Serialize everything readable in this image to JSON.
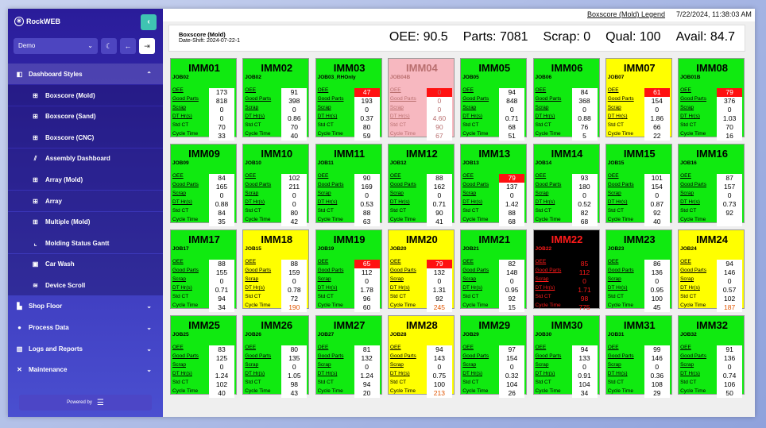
{
  "sidebar": {
    "brand": "RockWEB",
    "select": "Demo",
    "groups": [
      "Dashboard Styles",
      "Shop Floor",
      "Process Data",
      "Logs and Reports",
      "Maintenance"
    ],
    "sub_items": [
      "Boxscore (Mold)",
      "Boxscore (Sand)",
      "Boxscore (CNC)",
      "Assembly Dashboard",
      "Array (Mold)",
      "Array",
      "Multiple (Mold)",
      "Molding Status Gantt",
      "Car Wash",
      "Device Scroll"
    ],
    "powered": "Powered by"
  },
  "topbar": {
    "legend": "Boxscore (Mold) Legend",
    "datetime": "7/22/2024, 11:38:03 AM"
  },
  "header": {
    "title": "Boxscore (Mold)",
    "date_shift": "Date-Shift: 2024-07-22-1",
    "metrics": [
      {
        "label": "OEE:",
        "value": "90.5"
      },
      {
        "label": "Parts:",
        "value": "7081"
      },
      {
        "label": "Scrap:",
        "value": "0"
      },
      {
        "label": "Qual:",
        "value": "100"
      },
      {
        "label": "Avail:",
        "value": "84.7"
      }
    ]
  },
  "row_labels": [
    "OEE",
    "Good Parts",
    "Scrap",
    "DT Hr(s)",
    "Std CT",
    "Cycle Time"
  ],
  "colors": {
    "running": "#10ea10",
    "warning": "#ffff00",
    "idle": "#f7b8c0",
    "down": "#000000",
    "alert": "#ff1111"
  },
  "machines": [
    {
      "name": "IMM01",
      "job": "JOB02",
      "status": "green",
      "values": [
        "173",
        "818",
        "0",
        "0",
        "70",
        "33"
      ],
      "red_oee": false
    },
    {
      "name": "IMM02",
      "job": "JOB02",
      "status": "green",
      "values": [
        "91",
        "398",
        "0",
        "0.86",
        "70",
        "40"
      ],
      "red_oee": false
    },
    {
      "name": "IMM03",
      "job": "JOB03_RHOnly",
      "status": "green",
      "values": [
        "47",
        "193",
        "0",
        "0.37",
        "80",
        "59"
      ],
      "red_oee": true
    },
    {
      "name": "IMM04",
      "job": "JOB04B",
      "status": "pink",
      "values": [
        "0",
        "0",
        "0",
        "4.60",
        "90",
        "67"
      ],
      "red_oee": true
    },
    {
      "name": "IMM05",
      "job": "JOB05",
      "status": "green",
      "values": [
        "94",
        "848",
        "0",
        "0.71",
        "68",
        "51"
      ],
      "red_oee": false
    },
    {
      "name": "IMM06",
      "job": "JOB06",
      "status": "green",
      "values": [
        "84",
        "368",
        "0",
        "0.88",
        "76",
        "5"
      ],
      "red_oee": false
    },
    {
      "name": "IMM07",
      "job": "JOB07",
      "status": "yellow",
      "values": [
        "61",
        "154",
        "0",
        "1.86",
        "66",
        "22"
      ],
      "red_oee": true
    },
    {
      "name": "IMM08",
      "job": "JOB01B",
      "status": "green",
      "values": [
        "79",
        "376",
        "0",
        "1.03",
        "70",
        "16"
      ],
      "red_oee": true
    },
    {
      "name": "IMM09",
      "job": "JOB09",
      "status": "green",
      "values": [
        "84",
        "165",
        "0",
        "0.88",
        "84",
        "35"
      ],
      "red_oee": false
    },
    {
      "name": "IMM10",
      "job": "JOB10",
      "status": "green",
      "values": [
        "102",
        "211",
        "0",
        "0",
        "80",
        "42"
      ],
      "red_oee": false
    },
    {
      "name": "IMM11",
      "job": "JOB11",
      "status": "green",
      "values": [
        "90",
        "169",
        "0",
        "0.53",
        "88",
        "63"
      ],
      "red_oee": false
    },
    {
      "name": "IMM12",
      "job": "JOB12",
      "status": "green",
      "values": [
        "88",
        "162",
        "0",
        "0.71",
        "90",
        "41"
      ],
      "red_oee": false
    },
    {
      "name": "IMM13",
      "job": "JOB13",
      "status": "green",
      "values": [
        "79",
        "137",
        "0",
        "1.42",
        "88",
        "68"
      ],
      "red_oee": true
    },
    {
      "name": "IMM14",
      "job": "JOB14",
      "status": "green",
      "values": [
        "93",
        "180",
        "0",
        "0.52",
        "82",
        "68"
      ],
      "red_oee": false
    },
    {
      "name": "IMM15",
      "job": "JOB15",
      "status": "green",
      "values": [
        "101",
        "154",
        "0",
        "0.87",
        "92",
        "40"
      ],
      "red_oee": false
    },
    {
      "name": "IMM16",
      "job": "JOB16",
      "status": "green",
      "values": [
        "87",
        "157",
        "0",
        "0.73",
        "92",
        ""
      ],
      "red_oee": false
    },
    {
      "name": "IMM17",
      "job": "JOB17",
      "status": "green",
      "values": [
        "88",
        "155",
        "0",
        "0.71",
        "94",
        "34"
      ],
      "red_oee": false
    },
    {
      "name": "IMM18",
      "job": "JOB15",
      "status": "yellow",
      "values": [
        "88",
        "159",
        "0",
        "0.78",
        "72",
        "190"
      ],
      "red_oee": false,
      "ct_hi": true
    },
    {
      "name": "IMM19",
      "job": "JOB19",
      "status": "green",
      "values": [
        "65",
        "112",
        "0",
        "1.78",
        "96",
        "60"
      ],
      "red_oee": true
    },
    {
      "name": "IMM20",
      "job": "JOB20",
      "status": "yellow",
      "values": [
        "79",
        "132",
        "0",
        "1.31",
        "92",
        "245"
      ],
      "red_oee": true,
      "ct_hi": true
    },
    {
      "name": "IMM21",
      "job": "JOB21",
      "status": "green",
      "values": [
        "82",
        "148",
        "0",
        "0.95",
        "92",
        "15"
      ],
      "red_oee": false
    },
    {
      "name": "IMM22",
      "job": "JOB22",
      "status": "black",
      "values": [
        "85",
        "112",
        "0",
        "1.71",
        "98",
        "775"
      ],
      "red_oee": false
    },
    {
      "name": "IMM23",
      "job": "JOB23",
      "status": "green",
      "values": [
        "86",
        "136",
        "0",
        "0.95",
        "100",
        "45"
      ],
      "red_oee": false
    },
    {
      "name": "IMM24",
      "job": "JOB24",
      "status": "yellow",
      "values": [
        "94",
        "146",
        "0",
        "0.57",
        "102",
        "187"
      ],
      "red_oee": false,
      "ct_hi": true
    },
    {
      "name": "IMM25",
      "job": "JOB25",
      "status": "green",
      "values": [
        "83",
        "125",
        "0",
        "1.24",
        "102",
        "40"
      ],
      "red_oee": false
    },
    {
      "name": "IMM26",
      "job": "JOB26",
      "status": "green",
      "values": [
        "80",
        "135",
        "0",
        "1.05",
        "98",
        "43"
      ],
      "red_oee": false
    },
    {
      "name": "IMM27",
      "job": "JOB27",
      "status": "green",
      "values": [
        "81",
        "132",
        "0",
        "1.24",
        "94",
        "20"
      ],
      "red_oee": false
    },
    {
      "name": "IMM28",
      "job": "JOB28",
      "status": "yellow",
      "values": [
        "94",
        "143",
        "0",
        "0.75",
        "100",
        "213"
      ],
      "red_oee": false,
      "ct_hi": true
    },
    {
      "name": "IMM29",
      "job": "JOB29",
      "status": "green",
      "values": [
        "97",
        "154",
        "0",
        "0.32",
        "104",
        "26"
      ],
      "red_oee": false
    },
    {
      "name": "IMM30",
      "job": "JOB30",
      "status": "green",
      "values": [
        "94",
        "133",
        "0",
        "0.91",
        "104",
        "34"
      ],
      "red_oee": false
    },
    {
      "name": "IMM31",
      "job": "JOB31",
      "status": "green",
      "values": [
        "99",
        "146",
        "0",
        "0.36",
        "108",
        "29"
      ],
      "red_oee": false
    },
    {
      "name": "IMM32",
      "job": "JOB32",
      "status": "green",
      "values": [
        "91",
        "136",
        "0",
        "0.74",
        "106",
        "50"
      ],
      "red_oee": false
    }
  ]
}
